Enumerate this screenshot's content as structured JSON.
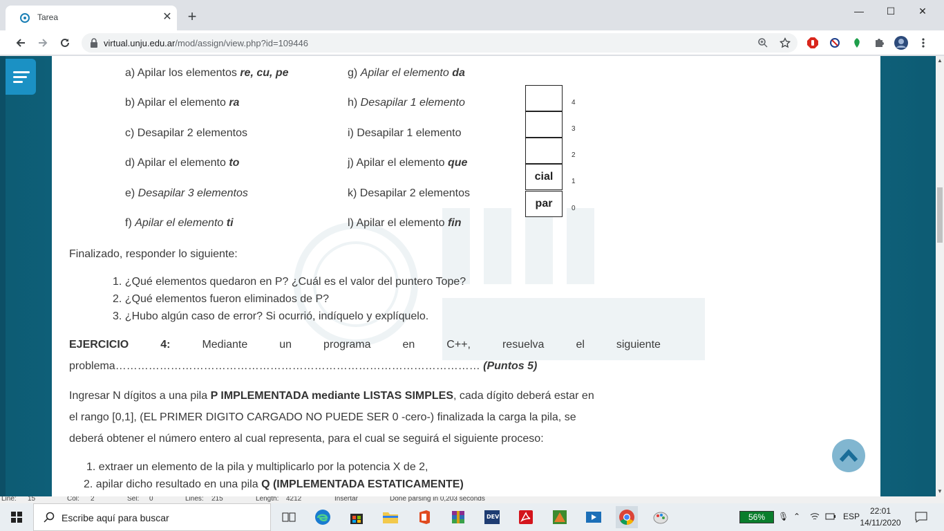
{
  "browser": {
    "tab_title": "Tarea",
    "tab_close": "✕",
    "new_tab": "+",
    "url_host": "virtual.unju.edu.ar",
    "url_path": "/mod/assign/view.php?id=109446"
  },
  "window_controls": {
    "minimize": "—",
    "maximize": "☐",
    "close": "✕"
  },
  "doc": {
    "left_column": [
      {
        "prefix": "a) Apilar los elementos ",
        "emph": "re, cu, pe",
        "italic": false
      },
      {
        "prefix": "b) Apilar el elemento ",
        "emph": "ra",
        "italic": false
      },
      {
        "prefix": "c) Desapilar 2 elementos",
        "emph": "",
        "italic": false
      },
      {
        "prefix": "d) Apilar el elemento ",
        "emph": "to",
        "italic": false
      },
      {
        "prefix": "e) ",
        "emph": "",
        "italic_text": "Desapilar 3 elementos"
      },
      {
        "prefix": "f)  ",
        "emph": "ti",
        "italic_text": "Apilar el elemento "
      }
    ],
    "right_column": [
      {
        "prefix": "g) ",
        "italic_text": "Apilar el elemento ",
        "emph": "da"
      },
      {
        "prefix": "h) ",
        "italic_text": "Desapilar 1 elemento",
        "emph": ""
      },
      {
        "prefix": "i) Desapilar 1 elemento",
        "italic_text": "",
        "emph": ""
      },
      {
        "prefix": "j) Apilar el elemento ",
        "italic_text": "",
        "emph": "que"
      },
      {
        "prefix": "k) Desapilar 2 elementos",
        "italic_text": "",
        "emph": ""
      },
      {
        "prefix": "l) Apilar el elemento ",
        "italic_text": "",
        "emph": "fin"
      }
    ],
    "stack": {
      "cells": [
        "",
        "",
        "",
        "cial",
        "par"
      ],
      "indices": [
        "4",
        "3",
        "2",
        "1",
        "0"
      ]
    },
    "finalizado": "Finalizado, responder lo siguiente:",
    "questions": [
      "1. ¿Qué elementos quedaron en P? ¿Cuál es el valor del puntero Tope?",
      "2. ¿Qué elementos fueron eliminados de P?",
      "3. ¿Hubo algún caso de error? Si ocurrió, indíquelo y explíquelo."
    ],
    "ejercicio_label": "EJERCICIO",
    "ejercicio_num": "4:",
    "ejercicio_words": [
      "Mediante",
      "un",
      "programa",
      "en",
      "C++,",
      "resuelva",
      "el",
      "siguiente"
    ],
    "problema_line": "problema………………………………………………………………………………………",
    "puntos": "(Puntos 5)",
    "para1_a": "Ingresar N dígitos a una pila ",
    "para1_b": "P IMPLEMENTADA mediante LISTAS SIMPLES",
    "para1_c": ", cada dígito deberá estar en",
    "para2": "el rango [0,1], (EL PRIMER DIGITO CARGADO NO PUEDE SER 0 -cero-) finalizada la carga la pila, se",
    "para3": "deberá obtener el número entero al cual representa, para el cual se seguirá el siguiente proceso:",
    "step1": "1. extraer un elemento de la pila y multiplicarlo por la potencia X de 2,",
    "step2_a": "2. apilar dicho resultado en una pila ",
    "step2_b": "Q (IMPLEMENTADA ESTATICAMENTE)"
  },
  "statusbar": [
    "Line:",
    "15",
    "Col:",
    "2",
    "Sel:",
    "0",
    "Lines:",
    "215",
    "Length:",
    "4212",
    "Insertar",
    "Done parsing in 0,203 seconds"
  ],
  "taskbar": {
    "search_placeholder": "Escribe aquí para buscar",
    "battery": "56%",
    "lang": "ESP",
    "time": "22:01",
    "date": "14/11/2020"
  },
  "colors": {
    "page_bg": "#1381a0",
    "menu_button": "#1b91c4",
    "battery": "#0a7d2c"
  }
}
